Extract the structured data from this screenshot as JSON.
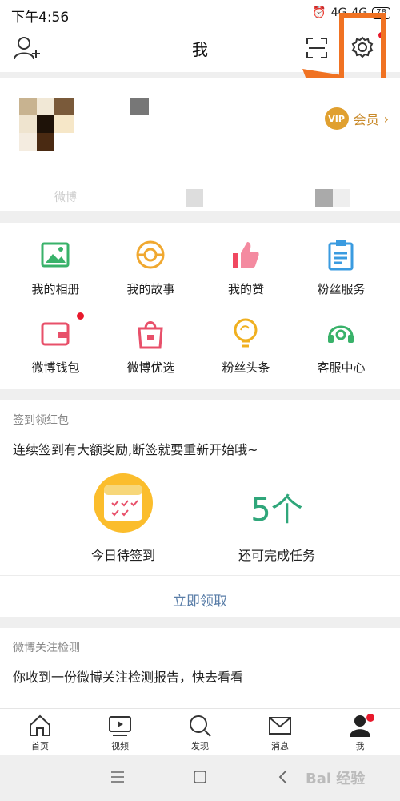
{
  "status": {
    "time": "下午4:56",
    "signal1": "4G",
    "signal2": "4G",
    "battery": "78"
  },
  "header": {
    "title": "我"
  },
  "profile": {
    "label_weibo": "微博",
    "vip_label": "会员",
    "vip_badge": "VIP"
  },
  "grid": {
    "items": [
      {
        "label": "我的相册"
      },
      {
        "label": "我的故事"
      },
      {
        "label": "我的赞"
      },
      {
        "label": "粉丝服务"
      },
      {
        "label": "微博钱包"
      },
      {
        "label": "微博优选"
      },
      {
        "label": "粉丝头条"
      },
      {
        "label": "客服中心"
      }
    ]
  },
  "checkin": {
    "section_title": "签到领红包",
    "description": "连续签到有大额奖励,断签就要重新开始哦~",
    "today_label": "今日待签到",
    "count": "5个",
    "tasks_label": "还可完成任务",
    "claim_button": "立即领取"
  },
  "detect": {
    "section_title": "微博关注检测",
    "description": "你收到一份微博关注检测报告，快去看看"
  },
  "tabbar": {
    "items": [
      {
        "label": "首页"
      },
      {
        "label": "视频"
      },
      {
        "label": "发现"
      },
      {
        "label": "消息"
      },
      {
        "label": "我"
      }
    ]
  },
  "watermark": "Bai 经验",
  "colors": {
    "accent": "#f07222",
    "link": "#5a7ea8",
    "green": "#2fa67a",
    "badge": "#e8192c"
  }
}
